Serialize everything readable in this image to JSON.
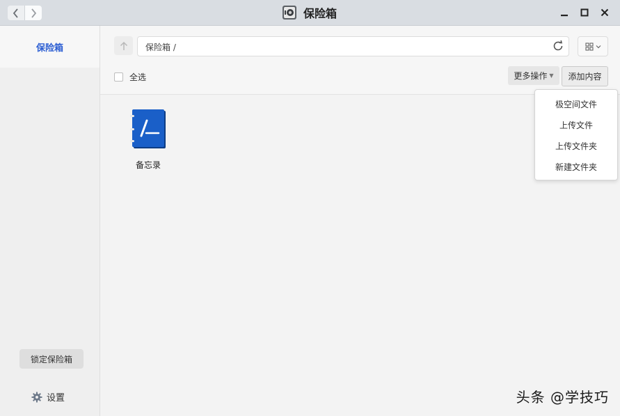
{
  "window": {
    "title": "保险箱",
    "icons": {
      "back": "chevron-left-icon",
      "forward": "chevron-right-icon",
      "minimize": "minimize-icon",
      "maximize": "maximize-icon",
      "close": "close-icon"
    }
  },
  "sidebar": {
    "active_item": "保险箱",
    "lock_button": "锁定保险箱",
    "settings_label": "设置",
    "accent_color": "#2d5fd3"
  },
  "toolbar": {
    "path": "保险箱 /",
    "select_all": "全选",
    "more_actions": "更多操作",
    "add_content": "添加内容"
  },
  "files": [
    {
      "name": "备忘录",
      "icon": "notebook-icon",
      "color": "#1a5fc8"
    }
  ],
  "dropdown": {
    "items": [
      "极空间文件",
      "上传文件",
      "上传文件夹",
      "新建文件夹"
    ]
  },
  "watermark": "头条 @学技巧"
}
